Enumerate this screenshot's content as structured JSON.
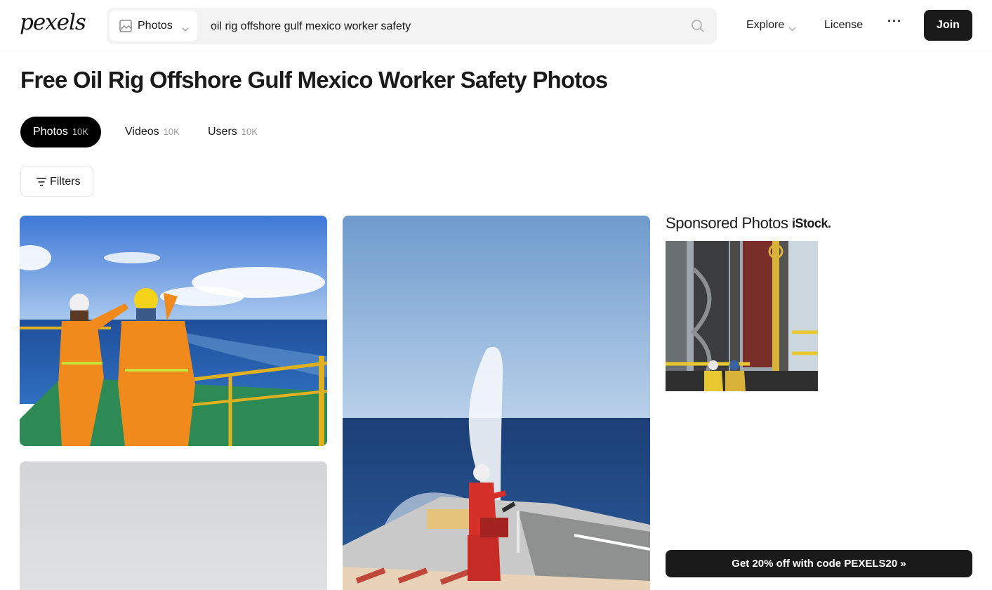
{
  "header": {
    "logo": "pexels",
    "search": {
      "type_label": "Photos",
      "query": "oil rig offshore gulf mexico worker safety",
      "type_icon": "image-icon",
      "submit_icon": "search-icon"
    },
    "nav": {
      "explore": "Explore",
      "license": "License",
      "more": "···",
      "join": "Join"
    }
  },
  "page": {
    "title": "Free Oil Rig Offshore Gulf Mexico Worker Safety Photos"
  },
  "tabs": [
    {
      "label": "Photos",
      "count": "10K",
      "active": true
    },
    {
      "label": "Videos",
      "count": "10K",
      "active": false
    },
    {
      "label": "Users",
      "count": "10K",
      "active": false
    }
  ],
  "filters": {
    "label": "Filters",
    "icon": "filter-icon"
  },
  "sponsored": {
    "title": "Sponsored Photos",
    "brand": "iStock.",
    "promo": "Get 20% off with code PEXELS20 »"
  },
  "photos": [
    {
      "subject": "workers in orange coveralls on ship deck pointing at sea"
    },
    {
      "subject": "worker spraying fire hose water over sea from helideck"
    },
    {
      "subject": "grey overcast sky"
    }
  ],
  "colors": {
    "primary": "#1a1a1a",
    "search_bg": "#f3f3f3",
    "muted": "#999999"
  }
}
